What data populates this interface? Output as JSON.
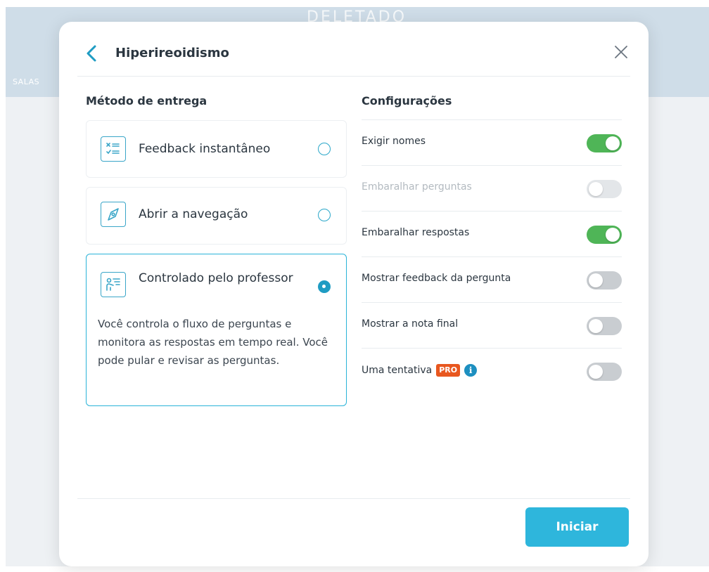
{
  "background": {
    "title": "DELETADO",
    "tab_salas": "SALAS"
  },
  "modal": {
    "title": "Hiperireoidismo",
    "delivery_title": "Método de entrega",
    "settings_title": "Configurações",
    "delivery_methods": [
      {
        "label": "Feedback instantâneo",
        "icon": "checklist-icon",
        "selected": false
      },
      {
        "label": "Abrir a navegação",
        "icon": "compass-icon",
        "selected": false
      },
      {
        "label": "Controlado pelo professor",
        "icon": "presenter-icon",
        "selected": true,
        "description": "Você controla o fluxo de perguntas e monitora as respostas em tempo real. Você pode pular e revisar as perguntas."
      }
    ],
    "settings": [
      {
        "label": "Exigir nomes",
        "on": true,
        "disabled": false
      },
      {
        "label": "Embaralhar perguntas",
        "on": false,
        "disabled": true
      },
      {
        "label": "Embaralhar respostas",
        "on": true,
        "disabled": false
      },
      {
        "label": "Mostrar feedback da pergunta",
        "on": false,
        "disabled": false
      },
      {
        "label": "Mostrar a nota final",
        "on": false,
        "disabled": false
      },
      {
        "label": "Uma tentativa",
        "on": false,
        "disabled": false,
        "badge": "PRO",
        "info": "i"
      }
    ],
    "start_label": "Iniciar"
  },
  "colors": {
    "accent": "#2eb6dc",
    "toggle_on": "#4fb557",
    "pro_badge": "#e8571f"
  }
}
